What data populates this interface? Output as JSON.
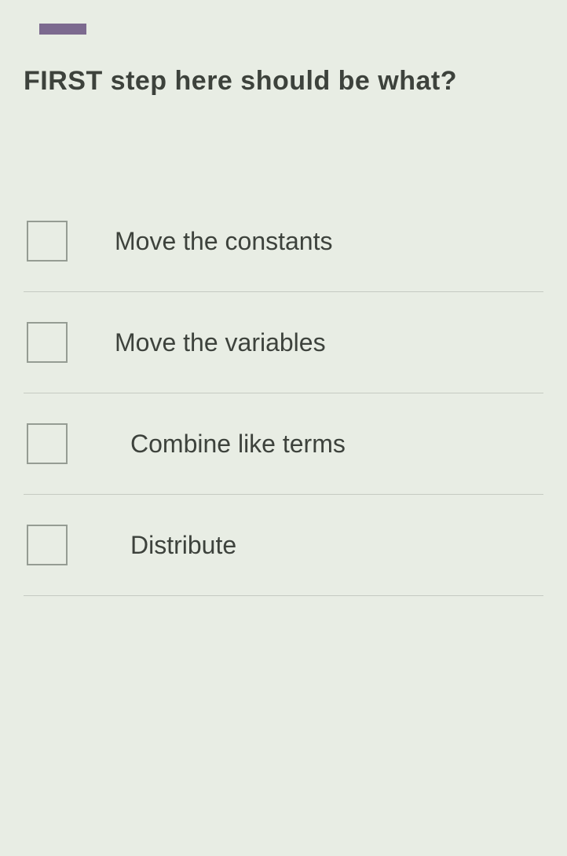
{
  "question": "FIRST step here should be what?",
  "options": [
    {
      "label": "Move the constants"
    },
    {
      "label": "Move the variables"
    },
    {
      "label": "Combine like terms"
    },
    {
      "label": "Distribute"
    }
  ]
}
